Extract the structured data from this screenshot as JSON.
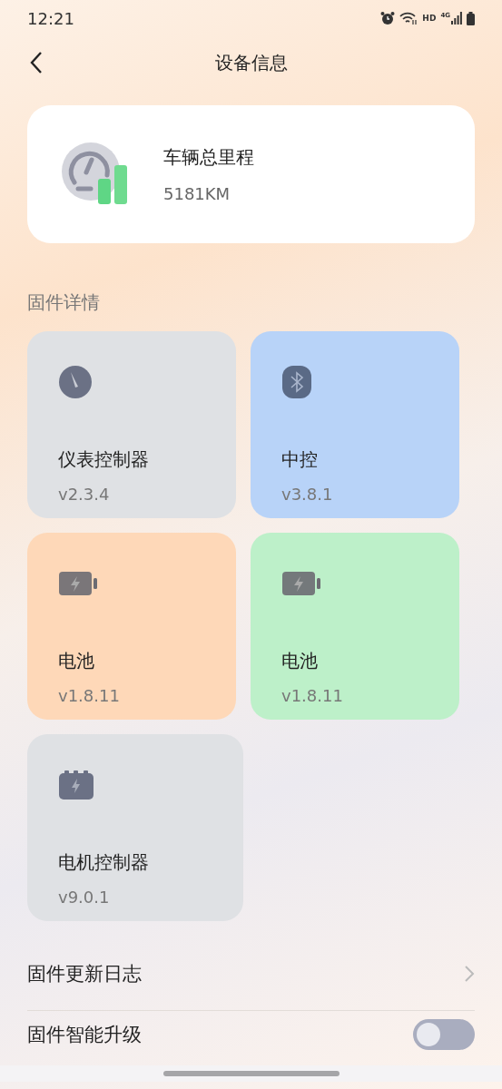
{
  "status_bar": {
    "time": "12:21",
    "network": "HD",
    "cellular": "4G"
  },
  "header": {
    "title": "设备信息"
  },
  "mileage": {
    "label": "车辆总里程",
    "value": "5181KM"
  },
  "firmware": {
    "heading": "固件详情",
    "items": [
      {
        "name": "仪表控制器",
        "version": "v2.3.4",
        "kind": "gauge",
        "color": "#dfe1e4"
      },
      {
        "name": "中控",
        "version": "v3.8.1",
        "kind": "bluetooth",
        "color": "#b8d3f8"
      },
      {
        "name": "电池",
        "version": "v1.8.11",
        "kind": "battery",
        "color": "#fed8b8"
      },
      {
        "name": "电池",
        "version": "v1.8.11",
        "kind": "battery",
        "color": "#bdf0c9"
      },
      {
        "name": "电机控制器",
        "version": "v9.0.1",
        "kind": "motor",
        "color": "#dfe1e4"
      }
    ]
  },
  "settings": [
    {
      "label": "固件更新日志",
      "kind": "link"
    },
    {
      "label": "固件智能升级",
      "kind": "toggle",
      "on": false
    }
  ]
}
